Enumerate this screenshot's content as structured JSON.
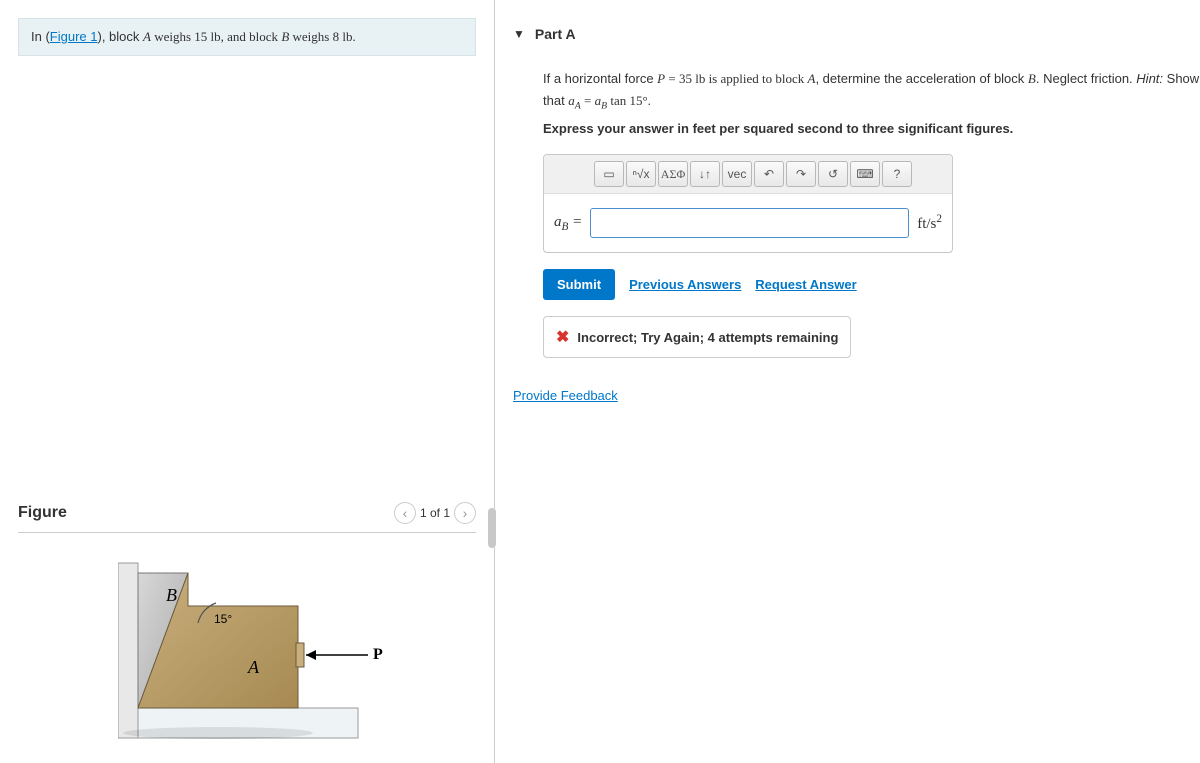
{
  "problem": {
    "prefix": "In (",
    "figure_link": "Figure 1",
    "text_1": "), block ",
    "block_a": "A",
    "weighs_a": " weighs 15 lb, and block ",
    "block_b": "B",
    "weighs_b": " weighs 8 lb."
  },
  "figure": {
    "title": "Figure",
    "counter": "1 of 1",
    "labels": {
      "A": "A",
      "B": "B",
      "P": "P",
      "angle": "15°"
    }
  },
  "part": {
    "title": "Part A",
    "q1": "If a horizontal force ",
    "q_var_p": "P",
    "q_eq": " = 35 lb is applied to block ",
    "q_a": "A",
    "q2": ", determine the acceleration of block ",
    "q_b": "B",
    "q3": ". Neglect friction. ",
    "hint_label": "Hint:",
    "hint_text": " Show that ",
    "hint_eq_lhs": "a",
    "hint_eq_sub_a": "A",
    "hint_eq_mid": " = ",
    "hint_eq_rhs": "a",
    "hint_eq_sub_b": "B",
    "hint_eq_tan": " tan 15°.",
    "instruction": "Express your answer in feet per squared second to three significant figures."
  },
  "toolbar": {
    "template": "▭",
    "root": "ⁿ√x",
    "greek": "ΑΣΦ",
    "subscript": "↓↑",
    "vec": "vec",
    "undo": "↶",
    "redo": "↷",
    "reset": "↺",
    "keyboard": "⌨",
    "help": "?"
  },
  "answer": {
    "var": "a",
    "var_sub": "B",
    "eq": " = ",
    "unit_base": "ft/s",
    "unit_exp": "2",
    "value": ""
  },
  "actions": {
    "submit": "Submit",
    "previous": "Previous Answers",
    "request": "Request Answer"
  },
  "feedback": {
    "message": "Incorrect; Try Again; 4 attempts remaining"
  },
  "provide_feedback": "Provide Feedback"
}
